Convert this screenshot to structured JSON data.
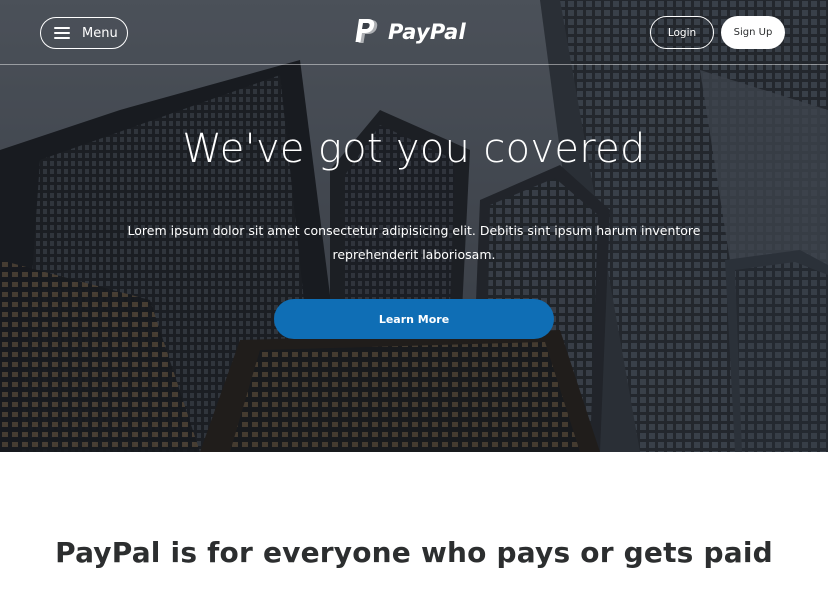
{
  "nav": {
    "menu_label": "Menu",
    "logo_text": "PayPal",
    "login_label": "Login",
    "signup_label": "Sign Up"
  },
  "hero": {
    "title": "We've got you covered",
    "text": "Lorem ipsum dolor sit amet consectetur adipisicing elit. Debitis sint ipsum harum inventore reprehenderit laboriosam.",
    "cta_label": "Learn More"
  },
  "section": {
    "title": "PayPal is for everyone who pays or gets paid"
  },
  "colors": {
    "brand_blue": "#0f6eb5",
    "text_dark": "#2c2e2f",
    "white": "#ffffff"
  },
  "icons": {
    "menu": "hamburger-icon",
    "logo": "paypal-logo-icon"
  }
}
